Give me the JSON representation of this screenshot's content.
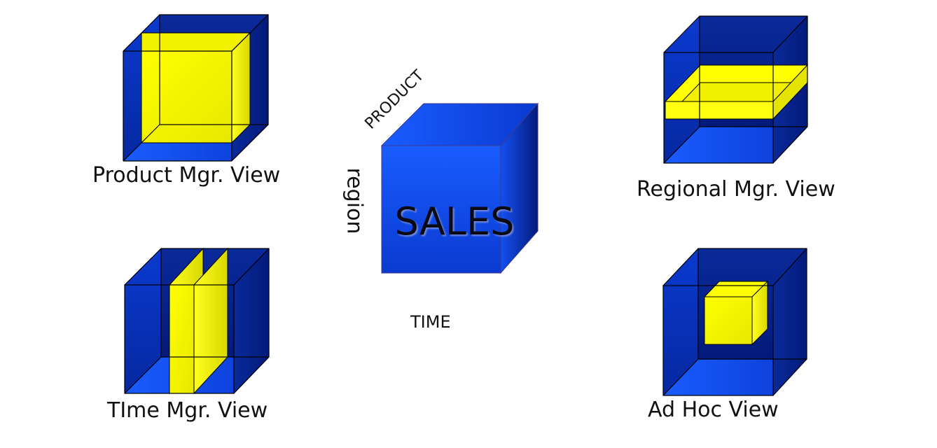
{
  "diagram": {
    "center_cube": {
      "label": "SALES",
      "axis_product": "PRODUCT",
      "axis_region": "region",
      "axis_time": "TIME"
    },
    "views": [
      {
        "id": "product",
        "caption": "Product Mgr. View"
      },
      {
        "id": "regional",
        "caption": "Regional Mgr. View"
      },
      {
        "id": "time",
        "caption": "TIme Mgr. View"
      },
      {
        "id": "adhoc",
        "caption": "Ad Hoc View"
      }
    ],
    "colors": {
      "cube_blue_light": "#1a5cff",
      "cube_blue_mid": "#0a3ad0",
      "cube_blue_dark": "#031a7a",
      "slice_yellow": "#ffff00",
      "slice_yellow_shade": "#e8e800",
      "edge": "#000000"
    }
  }
}
